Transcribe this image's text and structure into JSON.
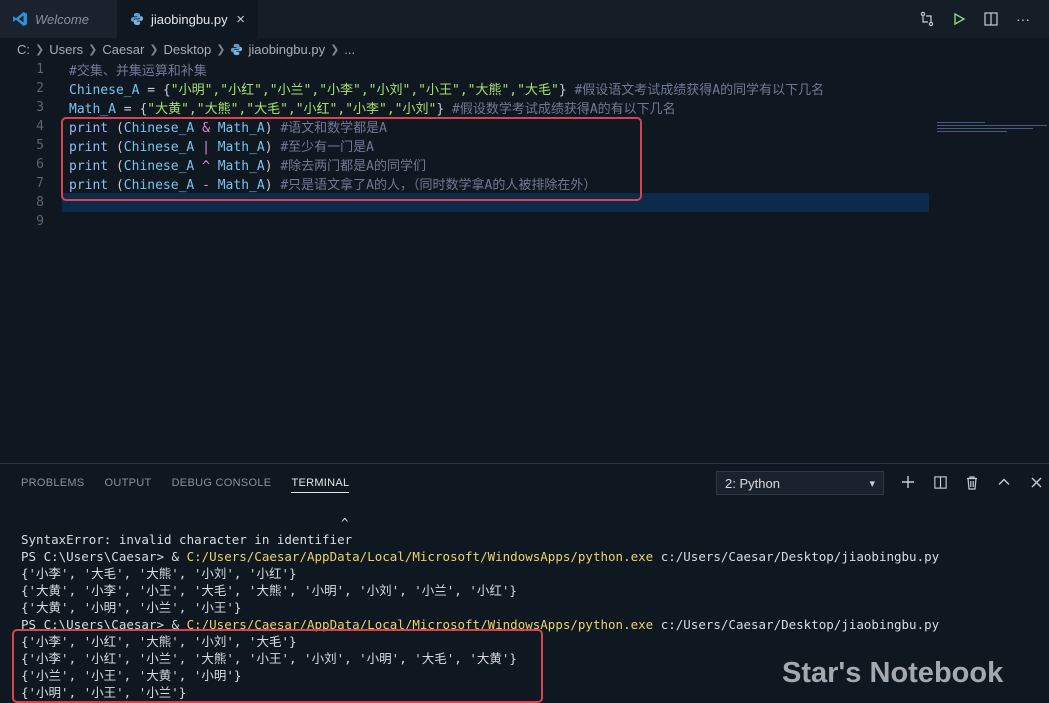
{
  "tabs": {
    "welcome": "Welcome",
    "file": "jiaobingbu.py",
    "close": "×"
  },
  "breadcrumb": {
    "items": [
      "C:",
      "Users",
      "Caesar",
      "Desktop",
      "jiaobingbu.py",
      "..."
    ]
  },
  "editor": {
    "line_numbers": [
      "1",
      "2",
      "3",
      "4",
      "5",
      "6",
      "7",
      "8",
      "9"
    ],
    "lines": [
      {
        "comment": "#交集、并集运算和补集"
      },
      {
        "var": "Chinese_A",
        "eq": " = {",
        "items": "\"小明\",\"小红\",\"小兰\",\"小李\",\"小刘\",\"小王\",\"大熊\",\"大毛\"",
        "close": "} ",
        "comment": "#假设语文考试成绩获得A的同学有以下几名"
      },
      {
        "var": "Math_A",
        "eq": " = {",
        "items": "\"大黄\",\"大熊\",\"大毛\",\"小红\",\"小李\",\"小刘\"",
        "close": "} ",
        "comment": "#假设数学考试成绩获得A的有以下几名"
      },
      {
        "fn": "print",
        "open": " (",
        "a": "Chinese_A",
        "op": " & ",
        "b": "Math_A",
        "close": ") ",
        "comment": "#语文和数学都是A"
      },
      {
        "fn": "print",
        "open": " (",
        "a": "Chinese_A",
        "op": " | ",
        "b": "Math_A",
        "close": ") ",
        "comment": "#至少有一门是A"
      },
      {
        "fn": "print",
        "open": " (",
        "a": "Chinese_A",
        "op": " ^ ",
        "b": "Math_A",
        "close": ") ",
        "comment": "#除去两门都是A的同学们"
      },
      {
        "fn": "print",
        "open": " (",
        "a": "Chinese_A",
        "op": " - ",
        "b": "Math_A",
        "close": ") ",
        "comment": "#只是语文拿了A的人，（同时数学拿A的人被排除在外）"
      }
    ]
  },
  "panel": {
    "tabs": [
      "PROBLEMS",
      "OUTPUT",
      "DEBUG CONSOLE",
      "TERMINAL"
    ],
    "terminal_select": "2: Python",
    "terminal": {
      "caret": "^",
      "error": "SyntaxError: invalid character in identifier",
      "prompt": "PS C:\\Users\\Caesar> & ",
      "python_path": "C:/Users/Caesar/AppData/Local/Microsoft/WindowsApps/python.exe",
      "script_path": " c:/Users/Caesar/Desktop/jiaobingbu.py",
      "run1": [
        "{'小李', '大毛', '大熊', '小刘', '小红'}",
        "{'大黄', '小李', '小王', '大毛', '大熊', '小明', '小刘', '小兰', '小红'}",
        "{'大黄', '小明', '小兰', '小王'}"
      ],
      "run2": [
        "{'小李', '小红', '大熊', '小刘', '大毛'}",
        "{'小李', '小红', '小兰', '大熊', '小王', '小刘', '小明', '大毛', '大黄'}",
        "{'小兰', '小王', '大黄', '小明'}",
        "{'小明', '小王', '小兰'}"
      ]
    }
  },
  "watermark": "Star's Notebook",
  "colors": {
    "background": "#0f1720",
    "highlight_line": "#0d2a4d",
    "annotation_box": "#d6454f",
    "string": "#a8e06f",
    "comment": "#6f7a94",
    "variable": "#76c5f0"
  }
}
